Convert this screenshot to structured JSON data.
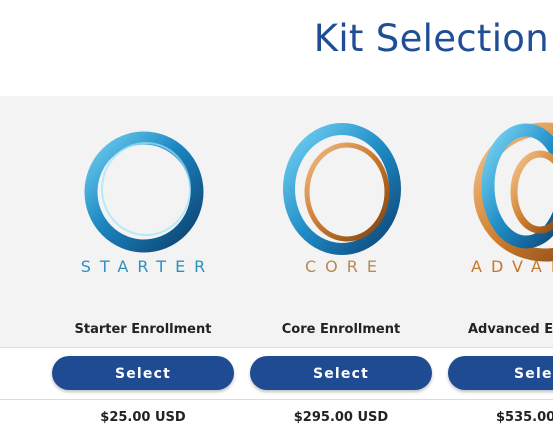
{
  "header": {
    "title": "Kit Selection"
  },
  "kits": [
    {
      "wordmark": "STARTER",
      "name": "Starter Enrollment",
      "select_label": "Select",
      "price": "$25.00 USD",
      "icon": "blue-ring-logo-icon"
    },
    {
      "wordmark": "CORE",
      "name": "Core Enrollment",
      "select_label": "Select",
      "price": "$295.00 USD",
      "icon": "blue-copper-ring-logo-icon"
    },
    {
      "wordmark": "ADVAN",
      "name": "Advanced En",
      "select_label": "Select",
      "price": "$535.00",
      "icon": "interlocked-rings-logo-icon"
    }
  ],
  "colors": {
    "brand_blue": "#1e4b91",
    "title_blue": "#1f4e95",
    "ring_blue": "#2a8fc4",
    "ring_copper": "#c8772b",
    "band_gray": "#f3f3f3"
  }
}
